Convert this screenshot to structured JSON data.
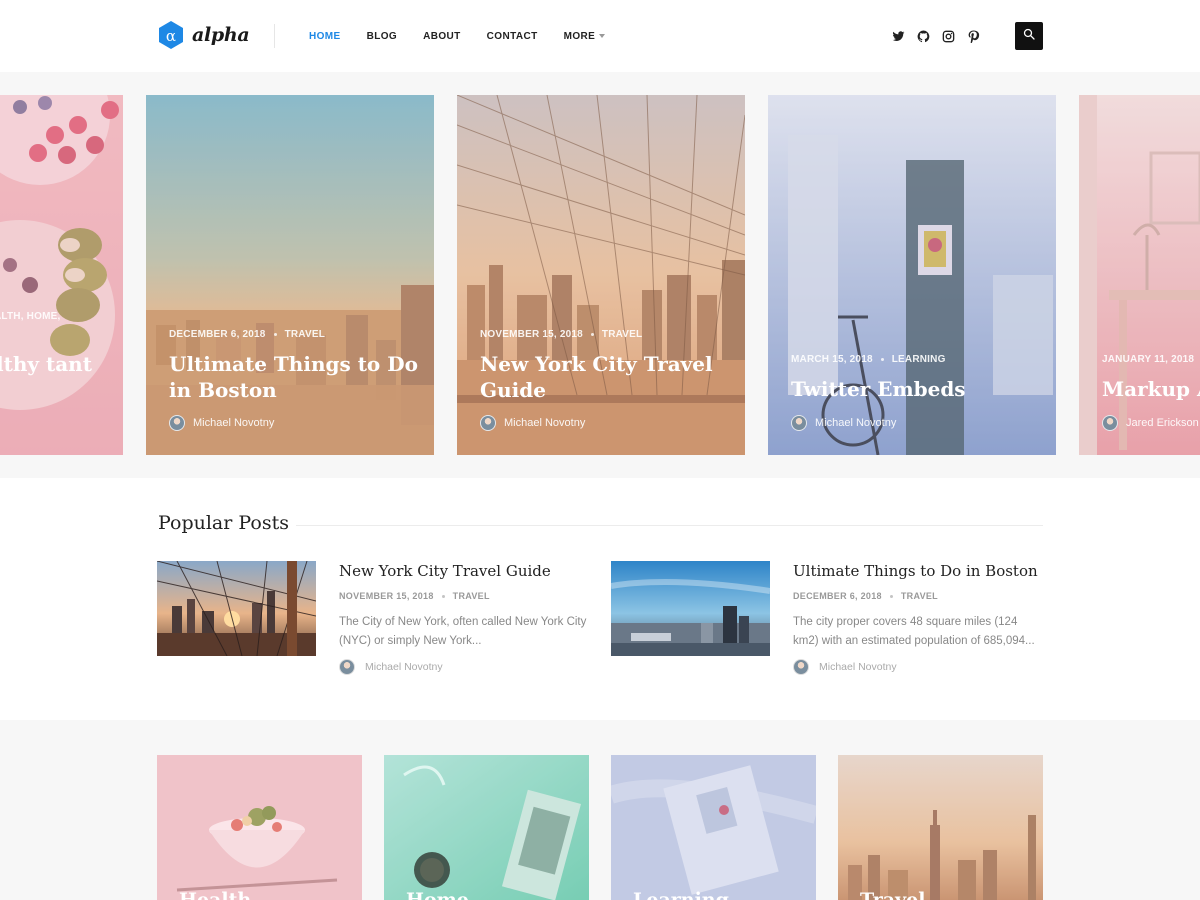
{
  "header": {
    "logo_text": "alpha",
    "logo_symbol": "α",
    "nav": [
      {
        "label": "HOME",
        "active": true
      },
      {
        "label": "BLOG",
        "active": false
      },
      {
        "label": "ABOUT",
        "active": false
      },
      {
        "label": "CONTACT",
        "active": false
      },
      {
        "label": "MORE",
        "active": false
      }
    ],
    "social_icons": [
      "twitter-icon",
      "github-icon",
      "instagram-icon",
      "pinterest-icon"
    ],
    "search_icon": "search-icon",
    "accent_color": "#1e88e5"
  },
  "carousel": {
    "slides": [
      {
        "date": "",
        "category": "ALTH, HOME,",
        "title": "lthy tant",
        "author": ""
      },
      {
        "date": "DECEMBER 6, 2018",
        "category": "TRAVEL",
        "title": "Ultimate Things to Do in Boston",
        "author": "Michael Novotny"
      },
      {
        "date": "NOVEMBER 15, 2018",
        "category": "TRAVEL",
        "title": "New York City Travel Guide",
        "author": "Michael Novotny"
      },
      {
        "date": "MARCH 15, 2018",
        "category": "LEARNING",
        "title": "Twitter Embeds",
        "author": "Michael Novotny"
      },
      {
        "date": "JANUARY 11, 2018",
        "category": "",
        "title": "Markup An",
        "author": "Jared Erickson"
      }
    ]
  },
  "popular": {
    "heading": "Popular Posts",
    "posts": [
      {
        "title": "New York City Travel Guide",
        "date": "NOVEMBER 15, 2018",
        "category": "TRAVEL",
        "excerpt": "The City of New York, often called New York City (NYC) or simply New York...",
        "author": "Michael Novotny"
      },
      {
        "title": "Ultimate Things to Do in Boston",
        "date": "DECEMBER 6, 2018",
        "category": "TRAVEL",
        "excerpt": "The city proper covers 48 square miles (124 km2) with an estimated population of 685,094...",
        "author": "Michael Novotny"
      }
    ]
  },
  "categories": [
    {
      "label": "Health"
    },
    {
      "label": "Home"
    },
    {
      "label": "Learning"
    },
    {
      "label": "Travel"
    }
  ]
}
